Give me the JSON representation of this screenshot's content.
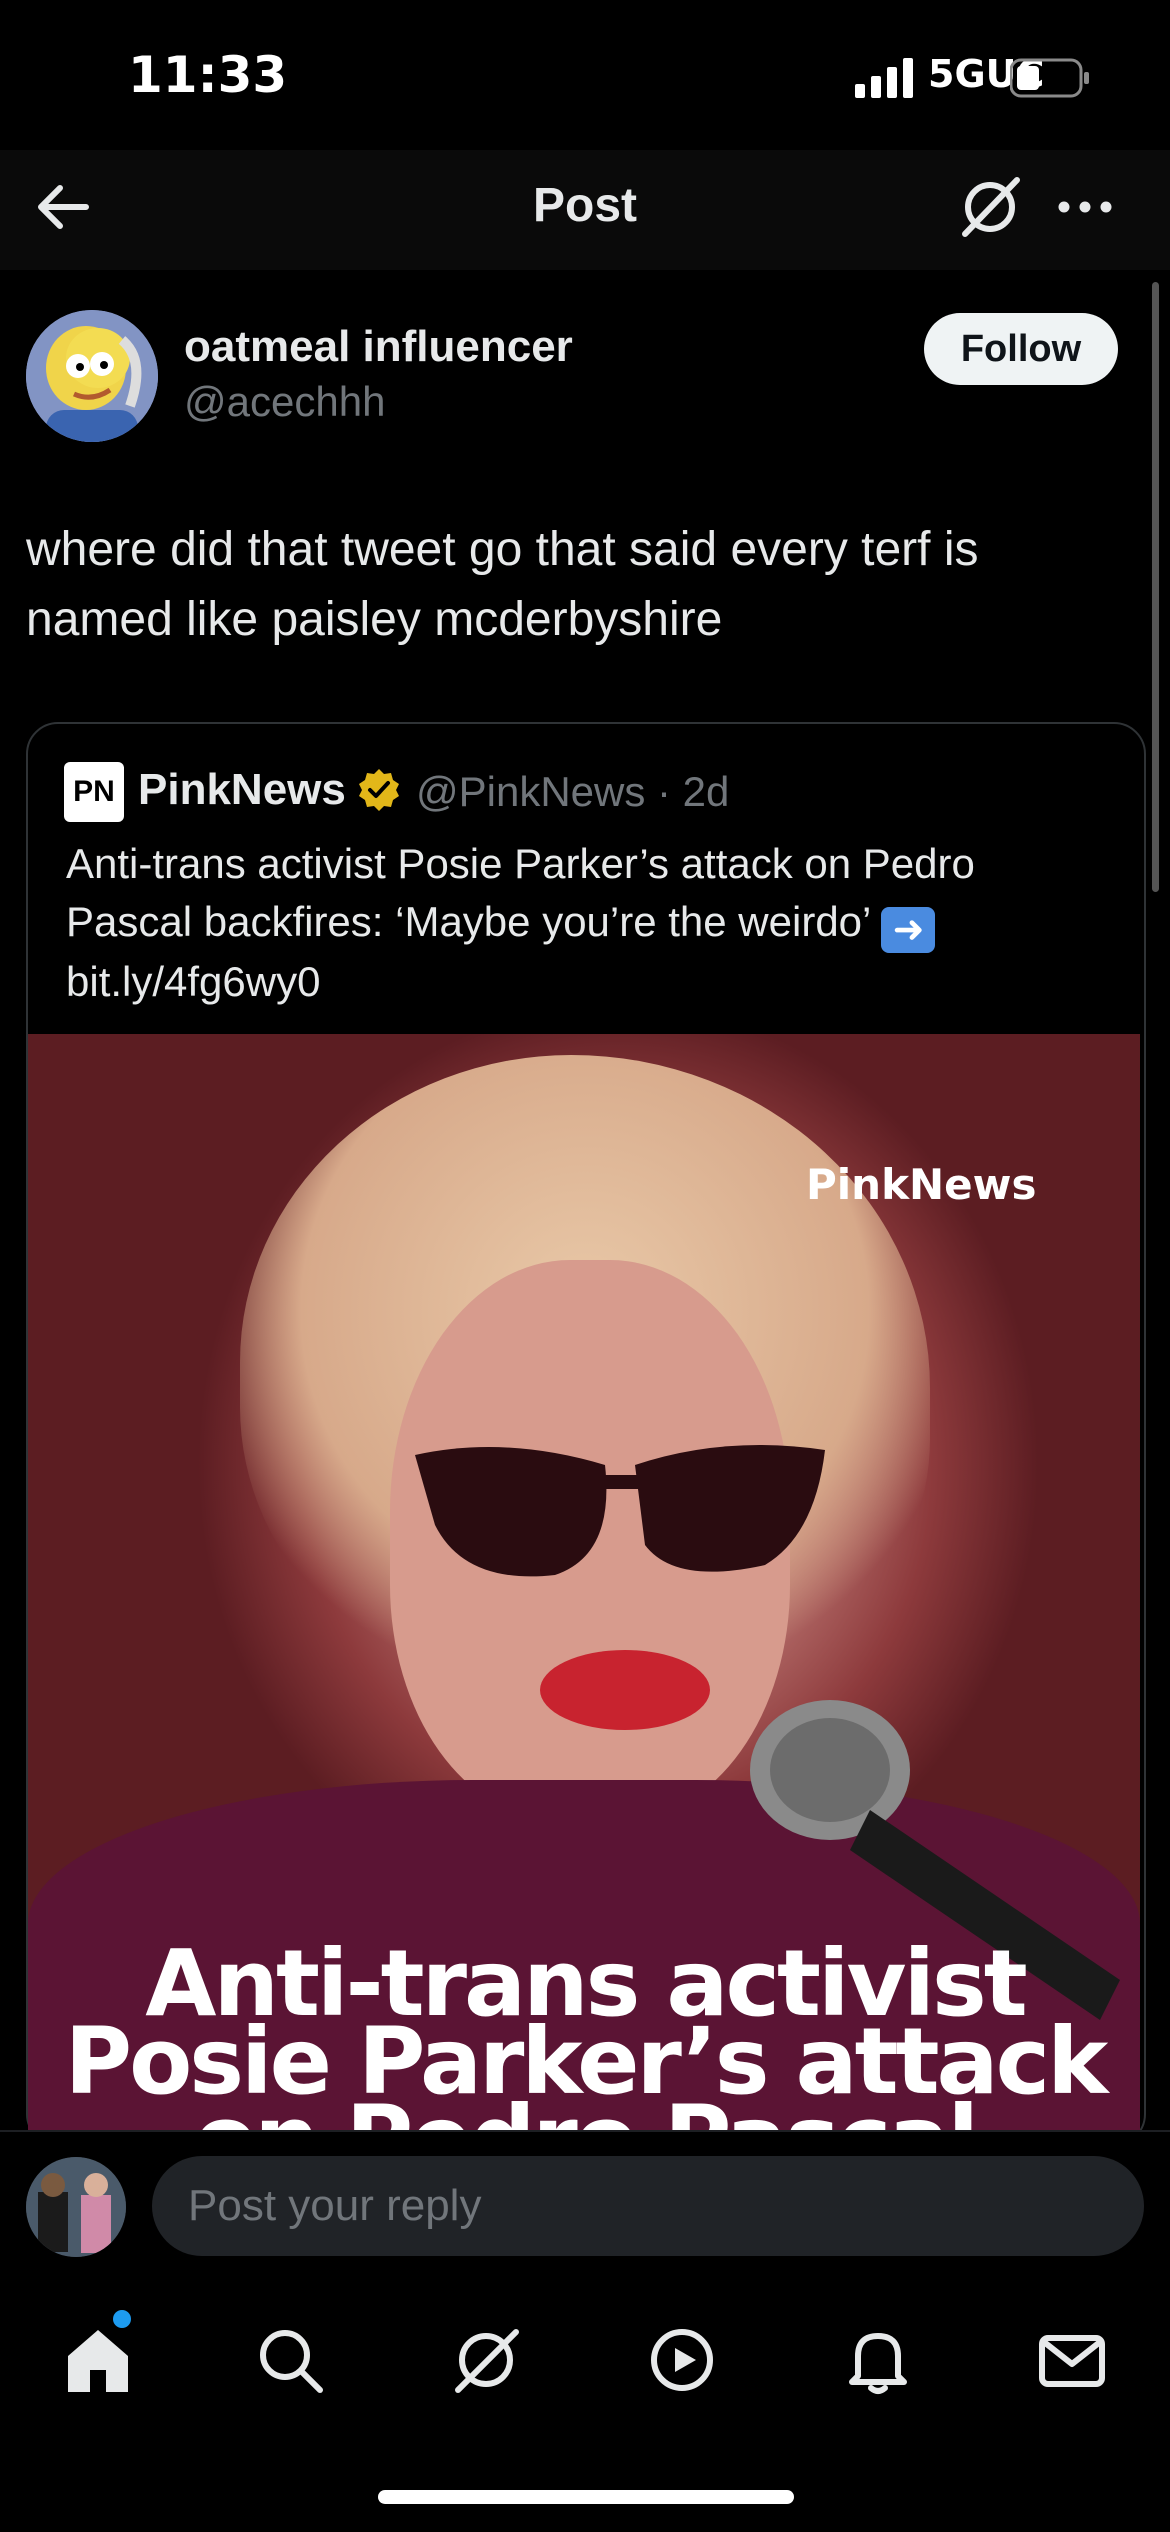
{
  "status_bar": {
    "time": "11:33",
    "network": "5GUC"
  },
  "header": {
    "title": "Post"
  },
  "post": {
    "author_name": "oatmeal influencer",
    "author_handle": "@acechhh",
    "follow_label": "Follow",
    "text": "where did that tweet go that said every terf is named like paisley mcderbyshire"
  },
  "quote": {
    "logo_text": "PN",
    "author_name": "PinkNews",
    "author_handle": "@PinkNews · 2d",
    "text": "Anti-trans activist Posie Parker’s attack on Pedro Pascal backfires: ‘Maybe you’re the weirdo’",
    "link": "bit.ly/4fg6wy0",
    "media_brand": "PinkNews",
    "media_headline": "Anti-trans activist Posie Parker’s attack on Pedro Pascal backfires: ‘Maybe"
  },
  "reply": {
    "placeholder": "Post your reply"
  },
  "nav": {
    "items": [
      "home-icon",
      "search-icon",
      "grok-icon",
      "video-icon",
      "notifications-icon",
      "messages-icon"
    ]
  },
  "colors": {
    "accent": "#1d9bf0",
    "verified": "#e2b719",
    "text_secondary": "#71767b"
  }
}
